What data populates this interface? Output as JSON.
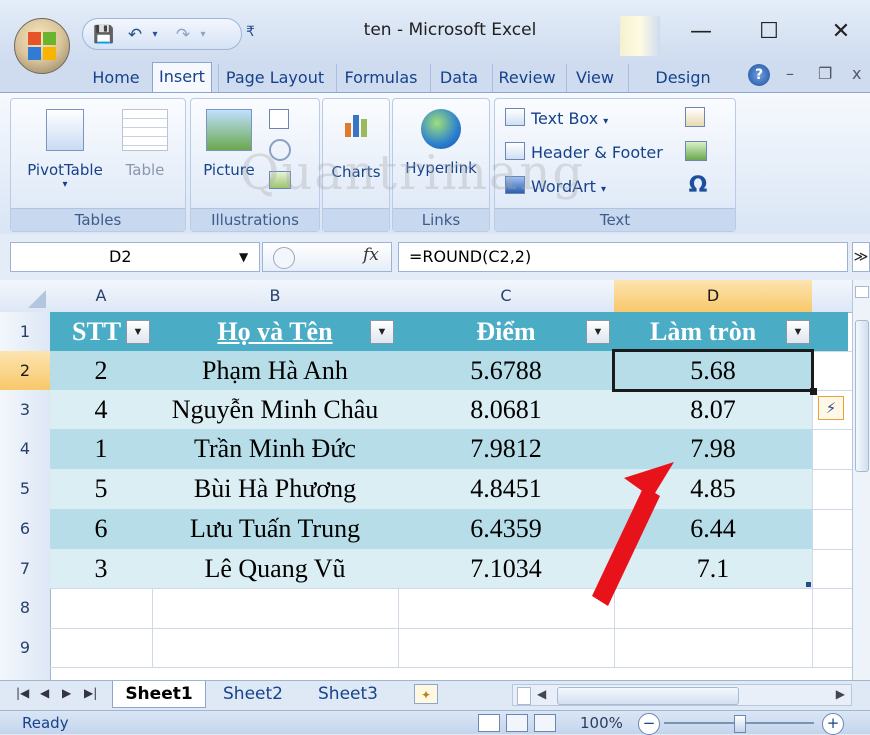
{
  "window": {
    "title": "ten - Microsoft Excel"
  },
  "ribbon_tabs": [
    "Home",
    "Insert",
    "Page Layout",
    "Formulas",
    "Data",
    "Review",
    "View",
    "Design"
  ],
  "active_tab": "Insert",
  "ribbon": {
    "tables": {
      "label": "Tables",
      "pivottable": "PivotTable",
      "table": "Table"
    },
    "illustrations": {
      "label": "Illustrations",
      "picture": "Picture"
    },
    "charts": {
      "label": "Charts"
    },
    "links": {
      "label": "Links",
      "hyperlink": "Hyperlink"
    },
    "text": {
      "label": "Text",
      "textbox": "Text Box",
      "header_footer": "Header & Footer",
      "wordart": "WordArt",
      "symbol": "Ω"
    }
  },
  "watermark": "Quantrimang",
  "formula_bar": {
    "name_box": "D2",
    "fx": "fx",
    "formula": "=ROUND(C2,2)"
  },
  "columns": [
    "A",
    "B",
    "C",
    "D"
  ],
  "rows": [
    "1",
    "2",
    "3",
    "4",
    "5",
    "6",
    "7",
    "8",
    "9"
  ],
  "table": {
    "headers": [
      "STT",
      "Họ và Tên",
      "Điểm",
      "Làm tròn"
    ],
    "rows": [
      [
        "2",
        "Phạm Hà Anh",
        "5.6788",
        "5.68"
      ],
      [
        "4",
        "Nguyễn Minh Châu",
        "8.0681",
        "8.07"
      ],
      [
        "1",
        "Trần Minh Đức",
        "7.9812",
        "7.98"
      ],
      [
        "5",
        "Bùi Hà Phương",
        "4.8451",
        "4.85"
      ],
      [
        "6",
        "Lưu Tuấn Trung",
        "6.4359",
        "6.44"
      ],
      [
        "3",
        "Lê Quang Vũ",
        "7.1034",
        "7.1"
      ]
    ]
  },
  "selected_cell": "D2",
  "sheets": [
    "Sheet1",
    "Sheet2",
    "Sheet3"
  ],
  "active_sheet": "Sheet1",
  "status": {
    "ready": "Ready",
    "zoom": "100%"
  },
  "colors": {
    "header_fill": "#4bacc6",
    "band_dark": "#b7dee8",
    "band_light": "#dbeef3",
    "arrow": "#e8121b"
  }
}
